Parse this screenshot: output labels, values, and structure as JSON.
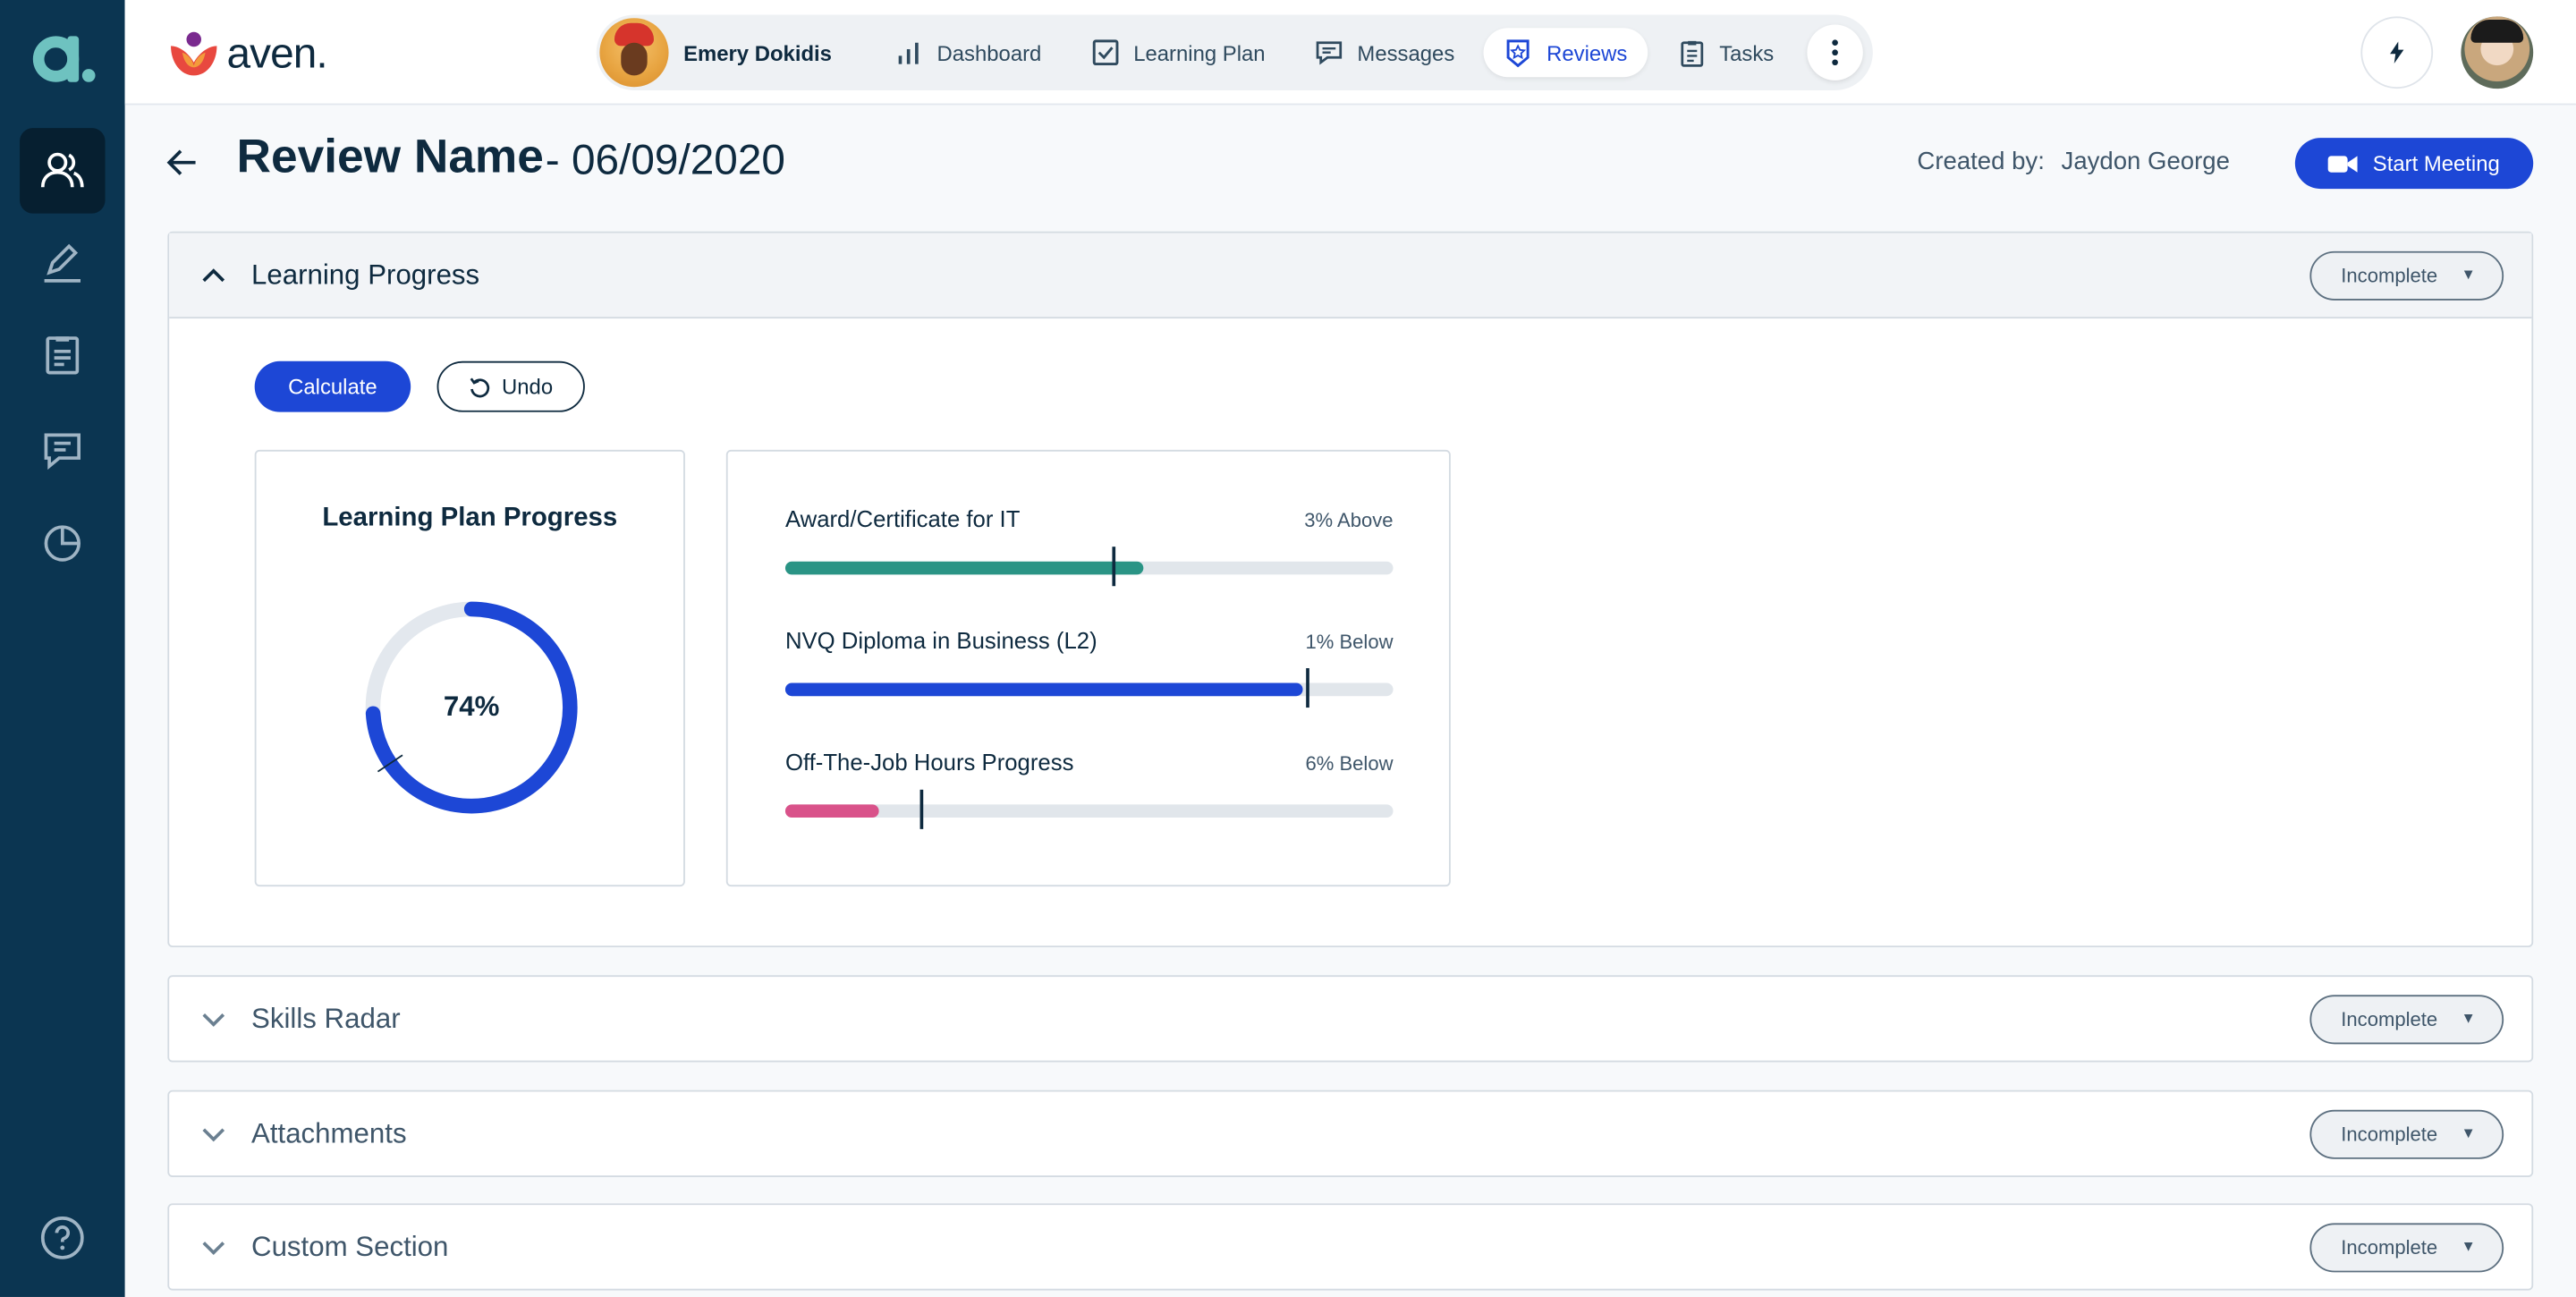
{
  "brand": {
    "name": "aven.",
    "logo_letter": "a."
  },
  "learner": {
    "name": "Emery Dokidis"
  },
  "nav": {
    "tabs": [
      {
        "label": "Dashboard",
        "icon": "bar-chart-icon"
      },
      {
        "label": "Learning Plan",
        "icon": "checkbox-icon"
      },
      {
        "label": "Messages",
        "icon": "chat-icon"
      },
      {
        "label": "Reviews",
        "icon": "review-badge-icon",
        "active": true
      },
      {
        "label": "Tasks",
        "icon": "clipboard-icon"
      }
    ]
  },
  "header": {
    "title": "Review Name",
    "date": "- 06/09/2020",
    "created_by_label": "Created by:",
    "created_by_name": "Jaydon George",
    "start_meeting_label": "Start Meeting"
  },
  "sections": {
    "learning_progress": {
      "title": "Learning Progress",
      "status": "Incomplete",
      "calculate_label": "Calculate",
      "undo_label": "Undo",
      "plan_progress": {
        "title": "Learning Plan Progress",
        "percent_label": "74%",
        "percent": 74
      },
      "bars": [
        {
          "name": "Award/Certificate for IT",
          "delta": "3% Above",
          "value": 0.59,
          "target": 0.54,
          "color": "#2a9485"
        },
        {
          "name": "NVQ Diploma in Business (L2)",
          "delta": "1% Below",
          "value": 0.85,
          "target": 0.86,
          "color": "#1d47d6"
        },
        {
          "name": "Off-The-Job Hours Progress",
          "delta": "6% Below",
          "value": 0.155,
          "target": 0.225,
          "color": "#d9528a"
        }
      ]
    },
    "skills_radar": {
      "title": "Skills Radar",
      "status": "Incomplete"
    },
    "attachments": {
      "title": "Attachments",
      "status": "Incomplete"
    },
    "custom_section": {
      "title": "Custom Section",
      "status": "Incomplete"
    }
  },
  "colors": {
    "sidebar": "#0b3551",
    "accent": "#1d47d6",
    "teal": "#2a9485",
    "pink": "#d9528a"
  }
}
